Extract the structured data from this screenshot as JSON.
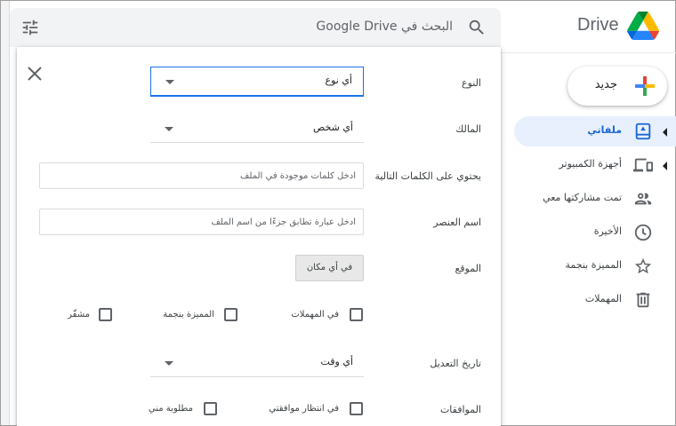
{
  "search": {
    "placeholder": "البحث في Google Drive"
  },
  "brand": {
    "name": "Drive"
  },
  "new_button": {
    "label": "جديد"
  },
  "sidebar": {
    "items": [
      {
        "label": "ملفاتي",
        "icon": "my-drive-icon",
        "active": true
      },
      {
        "label": "أجهزة الكمبيوتر",
        "icon": "computers-icon",
        "active": false
      },
      {
        "label": "تمت مشاركتها معي",
        "icon": "shared-icon",
        "active": false
      },
      {
        "label": "الأخيرة",
        "icon": "recent-icon",
        "active": false
      },
      {
        "label": "المميزة بنجمة",
        "icon": "star-icon",
        "active": false
      },
      {
        "label": "المهملات",
        "icon": "trash-icon",
        "active": false
      }
    ]
  },
  "dialog": {
    "type": {
      "label": "النوع",
      "value": "أي نوع"
    },
    "owner": {
      "label": "المالك",
      "value": "أي شخص"
    },
    "has_words": {
      "label": "يحتوي على الكلمات التالية",
      "placeholder": "أدخل كلمات موجودة في الملف"
    },
    "item_name": {
      "label": "اسم العنصر",
      "placeholder": "أدخل عبارة تطابق جزءًا من اسم الملف"
    },
    "location": {
      "label": "الموقع",
      "button": "في أي مكان",
      "checkboxes": {
        "trash": "في المهملات",
        "starred": "المميزة بنجمة",
        "encrypted": "مشفّر"
      }
    },
    "date_modified": {
      "label": "تاريخ التعديل",
      "value": "أي وقت"
    },
    "approvals": {
      "label": "الموافقات",
      "checkboxes": {
        "awaiting": "في انتظار موافقتي",
        "requested": "مطلوبة مني"
      }
    }
  },
  "colors": {
    "accent": "#1a73e8",
    "active_bg": "#e8f0fe",
    "active_text": "#1967d2",
    "search_bg": "#f1f3f4"
  }
}
